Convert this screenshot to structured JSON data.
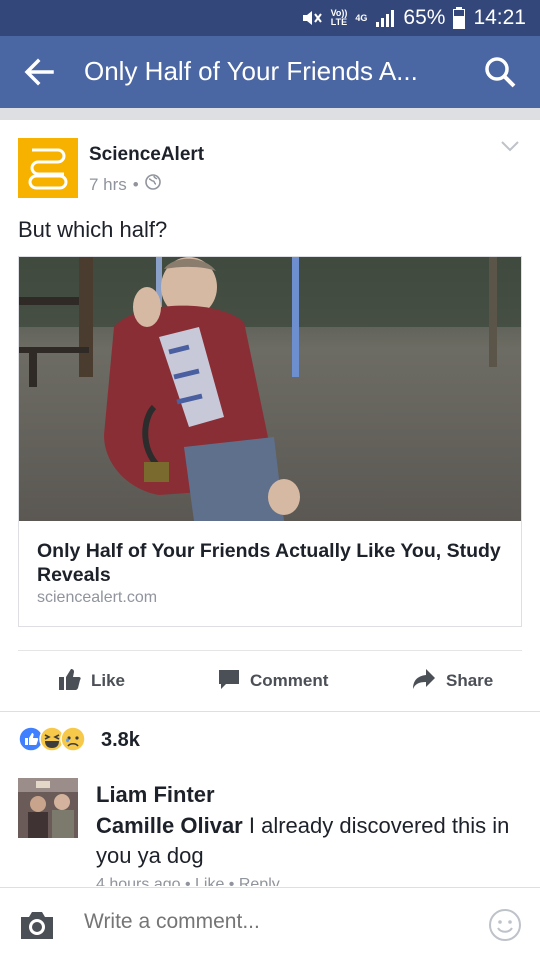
{
  "status_bar": {
    "volte": "Vo))",
    "lte": "LTE",
    "network": "4G",
    "battery": "65%",
    "time": "14:21"
  },
  "app_bar": {
    "title": "Only Half of Your Friends A...",
    "back_icon": "arrow-left-icon",
    "search_icon": "search-icon"
  },
  "post": {
    "page_name": "ScienceAlert",
    "timestamp": "7 hrs",
    "separator": "•",
    "privacy_icon": "globe-icon",
    "text": "But which half?",
    "link": {
      "title": "Only Half of Your Friends Actually Like You, Study Reveals",
      "domain": "sciencealert.com"
    },
    "actions": [
      {
        "label": "Like",
        "icon": "thumbs-up-icon"
      },
      {
        "label": "Comment",
        "icon": "comment-icon"
      },
      {
        "label": "Share",
        "icon": "share-arrow-icon"
      }
    ],
    "reactions": {
      "icons": [
        "like-reaction-icon",
        "haha-reaction-icon",
        "sad-reaction-icon"
      ],
      "count": "3.8k"
    }
  },
  "comment": {
    "author": "Liam Finter",
    "mention": "Camille Olivar",
    "text": " I already discovered this in you ya dog",
    "meta": "4 hours ago  •  Like  •  Reply"
  },
  "composer": {
    "placeholder": "Write a comment...",
    "camera_icon": "camera-icon",
    "emoji_icon": "smiley-icon"
  },
  "colors": {
    "status_bar": "#34477a",
    "app_bar": "#4a66a3",
    "logo": "#f7b200",
    "like_blue": "#4080ff"
  }
}
